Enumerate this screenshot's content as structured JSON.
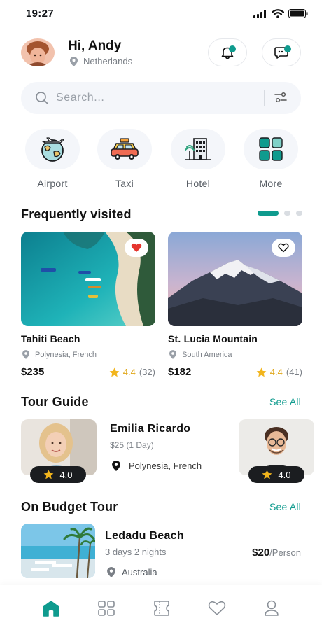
{
  "status_bar": {
    "time": "19:27"
  },
  "header": {
    "greeting": "Hi, Andy",
    "location": "Netherlands",
    "accent_color": "#0f9b8e"
  },
  "search": {
    "placeholder": "Search..."
  },
  "categories": [
    {
      "label": "Airport",
      "icon": "airport-globe-icon"
    },
    {
      "label": "Taxi",
      "icon": "taxi-icon"
    },
    {
      "label": "Hotel",
      "icon": "hotel-icon"
    },
    {
      "label": "More",
      "icon": "grid-icon"
    }
  ],
  "frequently_visited": {
    "title": "Frequently visited",
    "places": [
      {
        "name": "Tahiti Beach",
        "location": "Polynesia, French",
        "price": "$235",
        "rating": "4.4",
        "reviews": "(32)",
        "favorited": true
      },
      {
        "name": "St. Lucia Mountain",
        "location": "South America",
        "price": "$182",
        "rating": "4.4",
        "reviews": "(41)",
        "favorited": false
      }
    ]
  },
  "tour_guide": {
    "title": "Tour Guide",
    "see_all": "See All",
    "featured": {
      "name": "Emilia Ricardo",
      "price": "$25 (1 Day)",
      "location": "Polynesia, French"
    },
    "ratings": [
      "4.0",
      "4.0"
    ]
  },
  "budget_tour": {
    "title": "On Budget Tour",
    "see_all": "See All",
    "item": {
      "name": "Ledadu Beach",
      "duration": "3 days 2 nights",
      "location": "Australia",
      "price": "$20",
      "unit": "/Person"
    }
  },
  "bottom_nav": {
    "items": [
      "home-icon",
      "grid-icon",
      "ticket-icon",
      "heart-icon",
      "profile-icon"
    ],
    "active": "home-icon"
  }
}
